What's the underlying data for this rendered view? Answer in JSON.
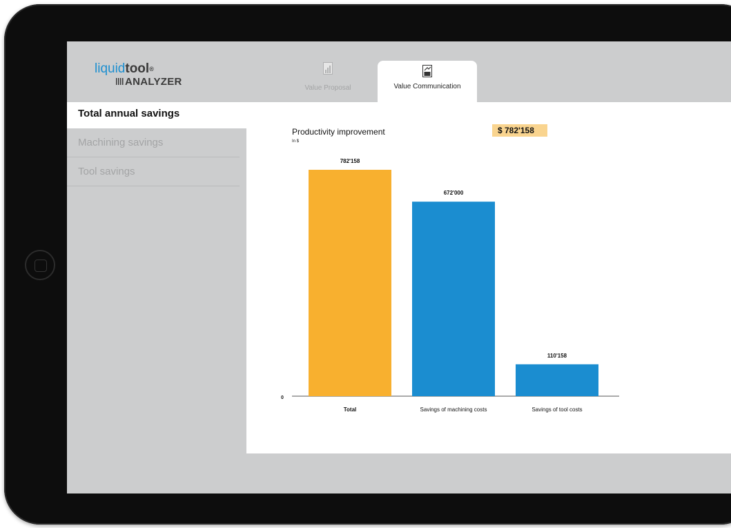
{
  "app": {
    "logo": {
      "liquid": "liquid",
      "tool": "tool",
      "reg": "®",
      "sub": "ANALYZER"
    },
    "tabs": [
      {
        "label": "Value Proposal",
        "active": false
      },
      {
        "label": "Value Communication",
        "active": true
      }
    ]
  },
  "sidebar": {
    "items": [
      {
        "label": "Total annual savings",
        "active": true
      },
      {
        "label": "Machining savings",
        "active": false
      },
      {
        "label": "Tool savings",
        "active": false
      }
    ]
  },
  "chart": {
    "title": "Productivity improvement",
    "unit": "In $",
    "total_badge": "$ 782'158",
    "zero_label": "0"
  },
  "colors": {
    "accent_orange": "#f8b02f",
    "accent_blue": "#1b8dd0",
    "badge": "#f9d48f",
    "logo_blue": "#1d8fd0"
  },
  "chart_data": {
    "type": "bar",
    "title": "Productivity improvement",
    "ylabel": "In $",
    "categories": [
      "Total",
      "Savings of machining costs",
      "Savings of tool costs"
    ],
    "values": [
      782158,
      672000,
      110158
    ],
    "value_labels": [
      "782'158",
      "672'000",
      "110'158"
    ],
    "colors": [
      "#f8b02f",
      "#1b8dd0",
      "#1b8dd0"
    ],
    "ylim": [
      0,
      782158
    ],
    "grid": false
  }
}
